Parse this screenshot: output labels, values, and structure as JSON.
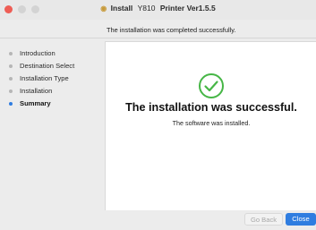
{
  "window": {
    "title_prefix": "Install",
    "title_model": "Y810",
    "title_suffix": "Printer Ver1.5.5",
    "package_icon": "package-icon"
  },
  "header": {
    "message": "The installation was completed successfully."
  },
  "sidebar": {
    "items": [
      {
        "label": "Introduction",
        "active": false
      },
      {
        "label": "Destination Select",
        "active": false
      },
      {
        "label": "Installation Type",
        "active": false
      },
      {
        "label": "Installation",
        "active": false
      },
      {
        "label": "Summary",
        "active": true
      }
    ]
  },
  "main": {
    "icon": "checkmark-circle-icon",
    "headline": "The installation was successful.",
    "subline": "The software was installed."
  },
  "buttons": {
    "back_label": "Go Back",
    "close_label": "Close"
  },
  "colors": {
    "accent": "#2f7de0",
    "success": "#46b646",
    "close_traffic": "#ee5d55"
  }
}
